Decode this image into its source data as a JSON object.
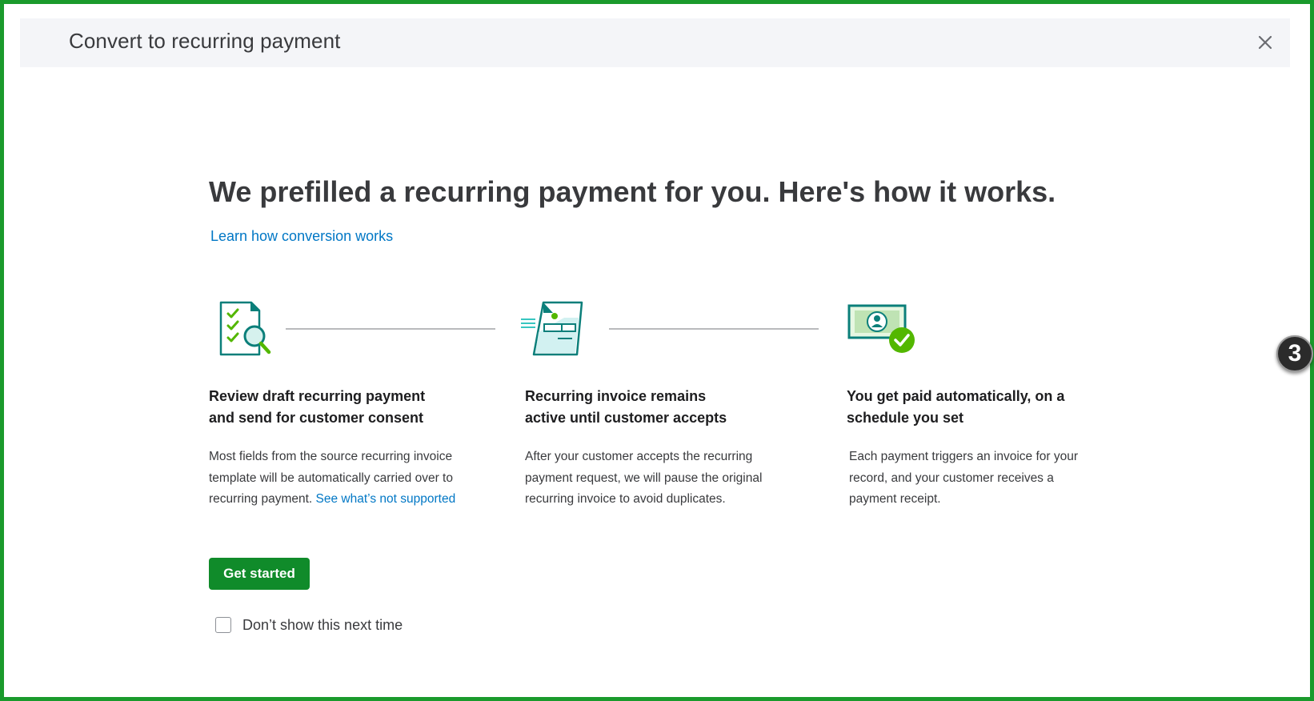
{
  "dialog": {
    "title": "Convert to recurring payment",
    "close_icon": "close-icon"
  },
  "content": {
    "headline": "We prefilled a recurring payment for you. Here's how it works.",
    "learn_link": "Learn how conversion works",
    "steps": [
      {
        "icon": "checklist-magnifier-icon",
        "title_line1": "Review draft recurring payment",
        "title_line2": "and send for customer consent",
        "desc_line1": "Most fields from the source recurring invoice",
        "desc_line2": "template will be automatically carried over to",
        "desc_line3": "recurring payment.",
        "desc_link": "See what’s not supported"
      },
      {
        "icon": "invoice-document-icon",
        "title_line1": "Recurring invoice remains",
        "title_line2": "active until customer accepts",
        "desc_line1": "After your customer accepts the recurring",
        "desc_line2": "payment request, we will pause the original",
        "desc_line3": "recurring invoice to avoid duplicates."
      },
      {
        "icon": "money-check-icon",
        "title_line1": "You get paid automatically, on a",
        "title_line2": "schedule you set",
        "desc_line1": "Each payment triggers an invoice for your",
        "desc_line2": "record, and your customer receives a",
        "desc_line3": "payment receipt."
      }
    ],
    "get_started_label": "Get started",
    "dont_show_label": "Don’t show this next time",
    "dont_show_checked": false
  },
  "overlay": {
    "step_badge": "3"
  },
  "colors": {
    "frame_border": "#1a9a2c",
    "header_bg": "#f4f5f8",
    "link": "#0077c5",
    "primary_button": "#108b2a",
    "icon_teal": "#0b7f7a",
    "icon_green": "#53b700"
  }
}
